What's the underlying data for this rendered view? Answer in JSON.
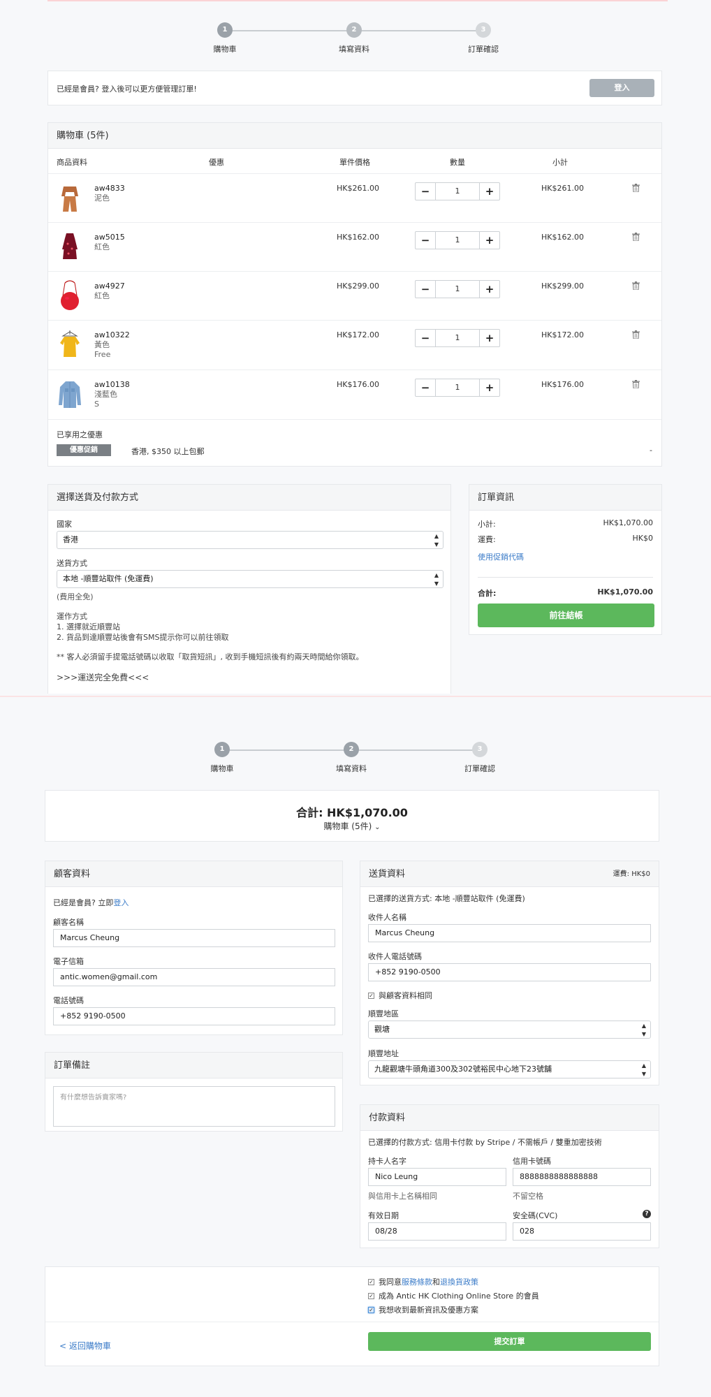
{
  "steps": [
    "購物車",
    "填寫資料",
    "訂單確認"
  ],
  "step_numbers": [
    "1",
    "2",
    "3"
  ],
  "login_bar": {
    "text": "已經是會員? 登入後可以更方便管理訂單!",
    "button": "登入"
  },
  "cart": {
    "title": "購物車 (5件)",
    "columns": [
      "商品資料",
      "優惠",
      "單件價格",
      "數量",
      "小計"
    ],
    "items": [
      {
        "sku": "aw4833",
        "variant1": "泥色",
        "variant2": "",
        "price": "HK$261.00",
        "qty": "1",
        "subtotal": "HK$261.00"
      },
      {
        "sku": "aw5015",
        "variant1": "紅色",
        "variant2": "",
        "price": "HK$162.00",
        "qty": "1",
        "subtotal": "HK$162.00"
      },
      {
        "sku": "aw4927",
        "variant1": "紅色",
        "variant2": "",
        "price": "HK$299.00",
        "qty": "1",
        "subtotal": "HK$299.00"
      },
      {
        "sku": "aw10322",
        "variant1": "黃色",
        "variant2": "Free",
        "price": "HK$172.00",
        "qty": "1",
        "subtotal": "HK$172.00"
      },
      {
        "sku": "aw10138",
        "variant1": "淺藍色",
        "variant2": "S",
        "price": "HK$176.00",
        "qty": "1",
        "subtotal": "HK$176.00"
      }
    ],
    "promo_title": "已享用之優惠",
    "promo_tag": "優惠促銷",
    "promo_text": "香港, $350 以上包郵",
    "promo_value": "-"
  },
  "shipping_method": {
    "title": "選擇送貨及付款方式",
    "country_label": "國家",
    "country": "香港",
    "method_label": "送貨方式",
    "method": "本地 -順豐站取件 (免運費)",
    "fee_note": "(費用全免)",
    "desc1": "運作方式",
    "desc2": "1. 選擇就近順豐站",
    "desc3": "2. 貨品到達順豐站後會有SMS提示你可以前往領取",
    "desc4": "** 客人必須留手提電話號碼以收取「取貨短訊」, 收到手機短訊後有約兩天時間給你領取。",
    "desc5": ">>>運送完全免費<<<"
  },
  "order_summary": {
    "title": "訂單資訊",
    "subtotal_label": "小計:",
    "subtotal": "HK$1,070.00",
    "shipping_label": "運費:",
    "shipping": "HK$0",
    "coupon_link": "使用促銷代碼",
    "total_label": "合計:",
    "total": "HK$1,070.00",
    "checkout": "前往結帳"
  },
  "page2": {
    "total_label": "合計: HK$1,070.00",
    "cart_toggle": "購物車 (5件)",
    "customer": {
      "title": "顧客資料",
      "member_prefix": "已經是會員? 立即",
      "login": "登入",
      "name_label": "顧客名稱",
      "name": "Marcus Cheung",
      "email_label": "電子信箱",
      "email": "antic.women@gmail.com",
      "phone_label": "電話號碼",
      "phone": "+852 9190-0500"
    },
    "remarks": {
      "title": "訂單備註",
      "placeholder": "有什麼想告訴賣家嗎?"
    },
    "delivery": {
      "title": "送貨資料",
      "fee": "運費: HK$0",
      "selected": "已選擇的送貨方式: 本地 -順豐站取件 (免運費)",
      "recipient_label": "收件人名稱",
      "recipient": "Marcus Cheung",
      "recipient_phone_label": "收件人電話號碼",
      "recipient_phone": "+852 9190-0500",
      "same_as_customer": "與顧客資料相同",
      "region_label": "順豐地區",
      "region": "觀塘",
      "address_label": "順豐地址",
      "address": "九龍觀塘牛頭角道300及302號裕民中心地下23號舖"
    },
    "payment": {
      "title": "付款資料",
      "selected": "已選擇的付款方式: 信用卡付款 by Stripe / 不需帳戶 / 雙重加密技術",
      "holder_label": "持卡人名字",
      "holder": "Nico Leung",
      "holder_hint": "與信用卡上名稱相同",
      "card_label": "信用卡號碼",
      "card": "8888888888888888",
      "card_hint": "不留空格",
      "expiry_label": "有效日期",
      "expiry": "08/28",
      "cvc_label": "安全碼(CVC)",
      "cvc": "028"
    },
    "agree": {
      "a1_prefix": "我同意",
      "a1_link1": "服務條款",
      "a1_mid": "和",
      "a1_link2": "退換貨政策",
      "a2": "成為 Antic HK Clothing Online Store 的會員",
      "a3": "我想收到最新資訊及優惠方案"
    },
    "back": "< 返回購物車",
    "submit": "提交訂單"
  },
  "colors": {
    "accent": "#5cb85c",
    "link": "#3a7bc8",
    "step_active": "#9aa1a8"
  }
}
